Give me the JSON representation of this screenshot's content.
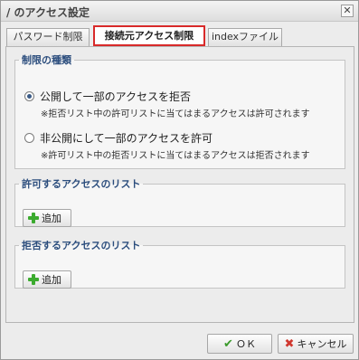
{
  "dialog": {
    "title": "/ のアクセス設定",
    "close_glyph": "✕"
  },
  "tabs": [
    {
      "label": "パスワード制限",
      "active": false
    },
    {
      "label": "接続元アクセス制限",
      "active": true
    },
    {
      "label": "indexファイル",
      "active": false
    }
  ],
  "restriction": {
    "legend": "制限の種類",
    "options": [
      {
        "label": "公開して一部のアクセスを拒否",
        "note": "※拒否リスト中の許可リストに当てはまるアクセスは許可されます",
        "checked": true
      },
      {
        "label": "非公開にして一部のアクセスを許可",
        "note": "※許可リスト中の拒否リストに当てはまるアクセスは拒否されます",
        "checked": false
      }
    ]
  },
  "allow_list": {
    "legend": "許可するアクセスのリスト",
    "add_label": "追加"
  },
  "deny_list": {
    "legend": "拒否するアクセスのリスト",
    "add_label": "追加"
  },
  "footer": {
    "ok_label": "ＯＫ",
    "cancel_label": "キャンセル"
  },
  "icons": {
    "add": "plus-icon",
    "ok": "check-icon",
    "cancel": "x-icon",
    "close": "close-icon"
  },
  "colors": {
    "active_tab_border": "#d82a2a",
    "legend_text": "#2b4d7d",
    "add_icon": "#3cab2f",
    "ok_icon": "#3a9a2b",
    "cancel_icon": "#d0382f"
  }
}
